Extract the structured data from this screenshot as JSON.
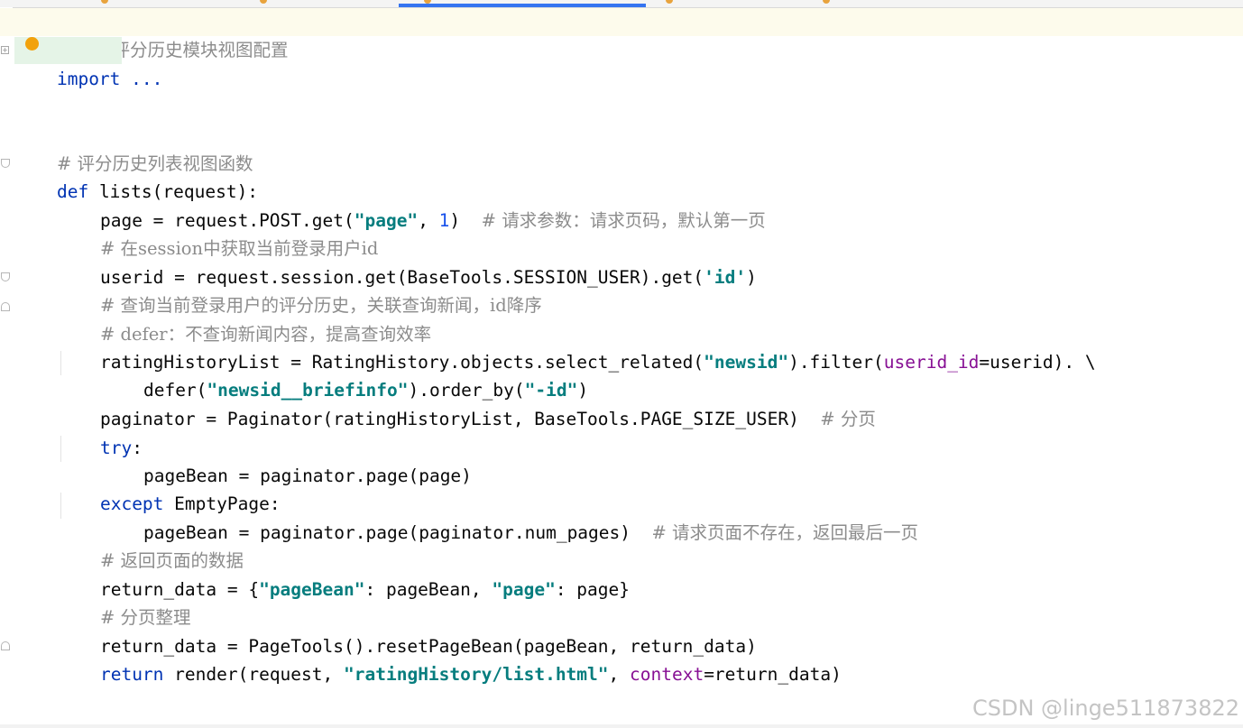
{
  "editor": {
    "language": "python",
    "colors": {
      "comment": "#8c8c8c",
      "keyword": "#0033b3",
      "string": "#067d7e",
      "number": "#1750eb",
      "kwarg": "#871094",
      "header_band": "#fdfbec",
      "fold_highlight": "#e5f4e7",
      "tab_indicator": "#3574f0"
    },
    "lines": {
      "l1": {
        "comment": "# 用户评分历史模块视图配置"
      },
      "l2": {
        "text": "import ..."
      },
      "l5": {
        "comment": "# 评分历史列表视图函数"
      },
      "l6": {
        "kw": "def",
        "rest": " lists(request):"
      },
      "l7": {
        "a": "page = request.POST.get(",
        "s1": "\"page\"",
        "b": ", ",
        "n1": "1",
        "c": ")  ",
        "comment": "# 请求参数：请求页码，默认第一页"
      },
      "l8": {
        "comment": "# 在session中获取当前登录用户id"
      },
      "l9": {
        "a": "userid = request.session.get(BaseTools.SESSION_USER).get(",
        "s1": "'id'",
        "b": ")"
      },
      "l10": {
        "comment": "# 查询当前登录用户的评分历史，关联查询新闻，id降序"
      },
      "l11": {
        "comment": "# defer：不查询新闻内容，提高查询效率"
      },
      "l12": {
        "a": "ratingHistoryList = RatingHistory.objects.select_related(",
        "s1": "\"newsid\"",
        "b": ").filter(",
        "kwarg": "userid_id",
        "c": "=userid). \\"
      },
      "l13": {
        "a": "defer(",
        "s1": "\"newsid__briefinfo\"",
        "b": ").order_by(",
        "s2": "\"-id\"",
        "c": ")"
      },
      "l14": {
        "a": "paginator = Paginator(ratingHistoryList, BaseTools.PAGE_SIZE_USER)  ",
        "comment": "# 分页"
      },
      "l15": {
        "kw": "try",
        "rest": ":"
      },
      "l16": {
        "text": "pageBean = paginator.page(page)"
      },
      "l17": {
        "kw": "except",
        "rest": " EmptyPage:"
      },
      "l18": {
        "a": "pageBean = paginator.page(paginator.num_pages)  ",
        "comment": "# 请求页面不存在，返回最后一页"
      },
      "l19": {
        "comment": "# 返回页面的数据"
      },
      "l20": {
        "a": "return_data = {",
        "s1": "\"pageBean\"",
        "b": ": pageBean, ",
        "s2": "\"page\"",
        "c": ": page}"
      },
      "l21": {
        "comment": "# 分页整理"
      },
      "l22": {
        "text": "return_data = PageTools().resetPageBean(pageBean, return_data)"
      },
      "l23": {
        "kw": "return",
        "a": " render(request, ",
        "s1": "\"ratingHistory/list.html\"",
        "b": ", ",
        "kwarg": "context",
        "c": "=return_data)"
      }
    }
  },
  "watermark": {
    "text": "CSDN @linge511873822"
  }
}
